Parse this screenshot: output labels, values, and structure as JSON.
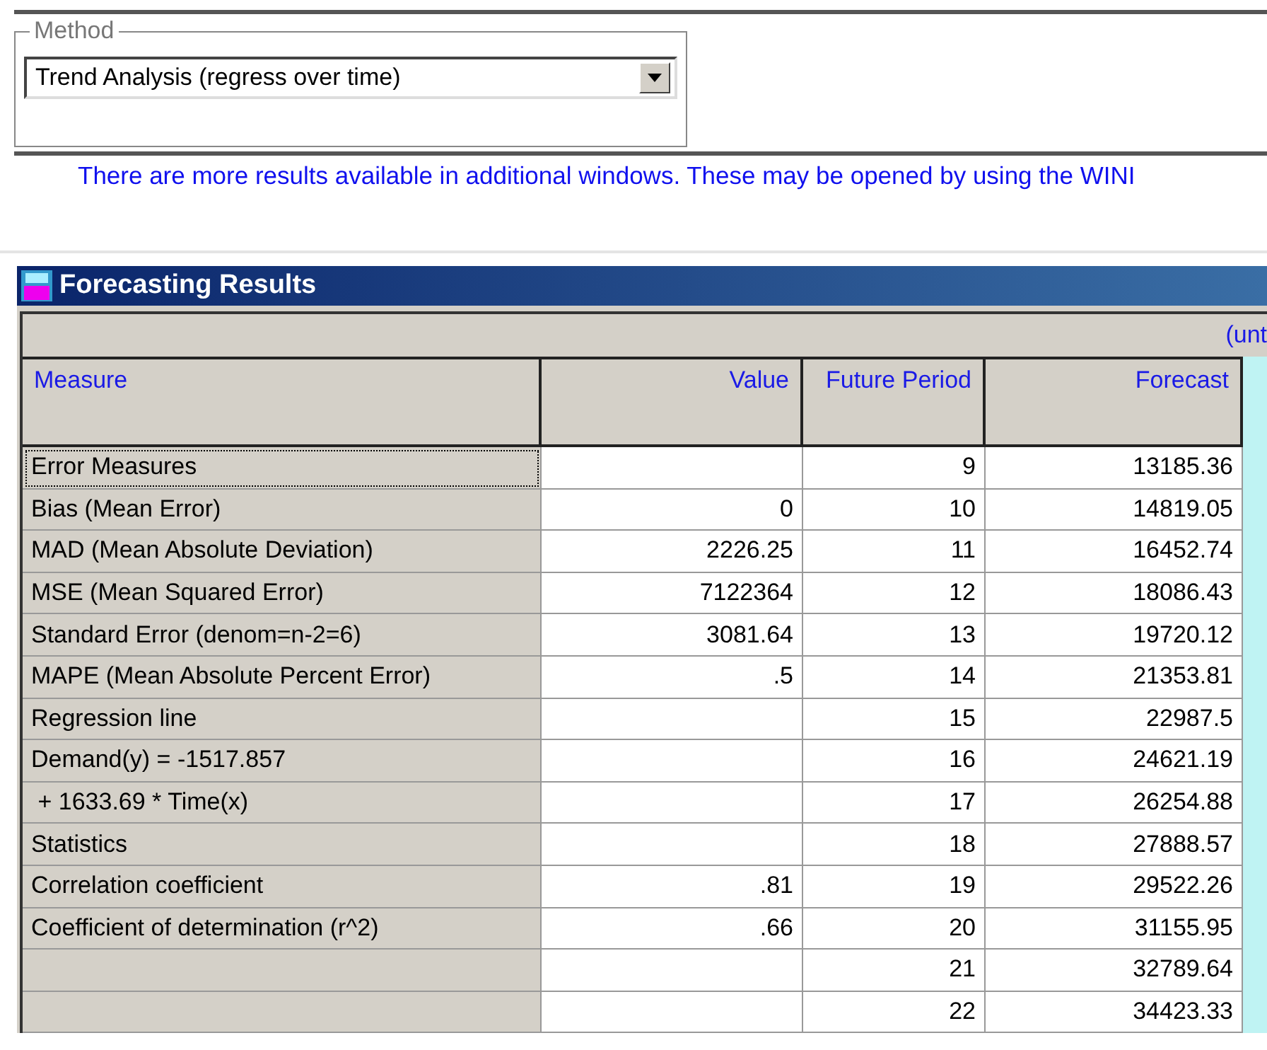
{
  "method": {
    "label": "Method",
    "value": "Trend Analysis (regress over time)"
  },
  "notice": "There are more results available in additional windows. These may be opened by using the WINI",
  "results_window": {
    "title": "Forecasting Results",
    "band_text": "(unt",
    "columns": [
      "Measure",
      "Value",
      "Future Period",
      "Forecast"
    ],
    "rows": [
      {
        "measure": "Error Measures",
        "period": "9",
        "forecast": "13185.36",
        "focused": true
      },
      {
        "measure": "Bias (Mean Error)",
        "value": "0",
        "period": "10",
        "forecast": "14819.05",
        "focused": false
      },
      {
        "measure": "MAD (Mean Absolute Deviation)",
        "value": "2226.25",
        "period": "11",
        "forecast": "16452.74",
        "focused": false
      },
      {
        "measure": "MSE (Mean Squared Error)",
        "value": "7122364",
        "period": "12",
        "forecast": "18086.43",
        "focused": false
      },
      {
        "measure": "Standard Error (denom=n-2=6)",
        "value": "3081.64",
        "period": "13",
        "forecast": "19720.12",
        "focused": false
      },
      {
        "measure": "MAPE (Mean Absolute Percent Error)",
        "value": ".5",
        "period": "14",
        "forecast": "21353.81",
        "focused": false
      },
      {
        "measure": "Regression line",
        "period": "15",
        "forecast": "22987.5",
        "focused": false
      },
      {
        "measure": "Demand(y) = -1517.857",
        "period": "16",
        "forecast": "24621.19",
        "focused": false
      },
      {
        "measure": " + 1633.69 * Time(x)",
        "period": "17",
        "forecast": "26254.88",
        "focused": false
      },
      {
        "measure": "Statistics",
        "period": "18",
        "forecast": "27888.57",
        "focused": false
      },
      {
        "measure": "Correlation coefficient",
        "value": ".81",
        "period": "19",
        "forecast": "29522.26",
        "focused": false
      },
      {
        "measure": "Coefficient of determination (r^2)",
        "value": ".66",
        "period": "20",
        "forecast": "31155.95",
        "focused": false
      },
      {
        "period": "21",
        "forecast": "32789.64",
        "focused": false
      },
      {
        "period": "22",
        "forecast": "34423.33",
        "focused": false
      }
    ]
  }
}
